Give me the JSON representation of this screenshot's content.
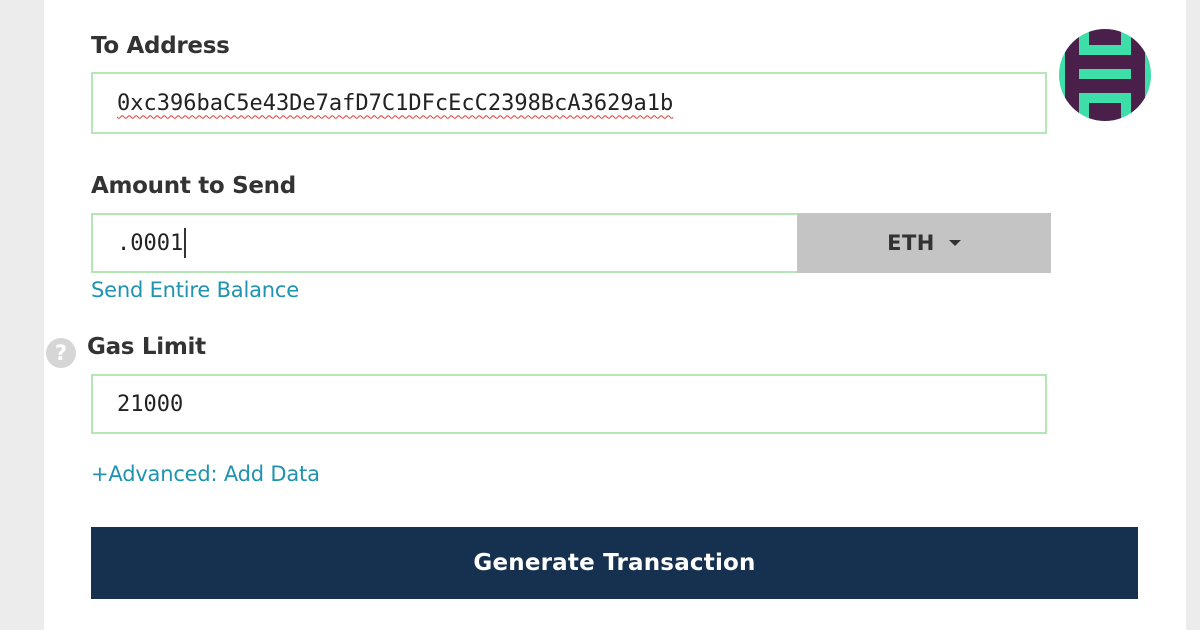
{
  "to_address": {
    "label": "To Address",
    "value": "0xc396baC5e43De7afD7C1DFcEcC2398BcA3629a1b"
  },
  "amount": {
    "label": "Amount to Send",
    "value": ".0001",
    "unit": "ETH",
    "send_all_link": "Send Entire Balance"
  },
  "gas": {
    "label": "Gas Limit",
    "help_icon_glyph": "?",
    "value": "21000"
  },
  "advanced_link": "+Advanced: Add Data",
  "generate_button": "Generate Transaction",
  "colors": {
    "field_border": "#b5e6b5",
    "link": "#1f93b0",
    "primary_button": "#163150",
    "unit_button": "#c4c4c4",
    "identicon_primary": "#3ddea8",
    "identicon_secondary": "#4a1f4a"
  },
  "icons": {
    "address_identicon": "identicon-avatar",
    "help": "question-circle-icon",
    "dropdown": "caret-down-icon"
  }
}
